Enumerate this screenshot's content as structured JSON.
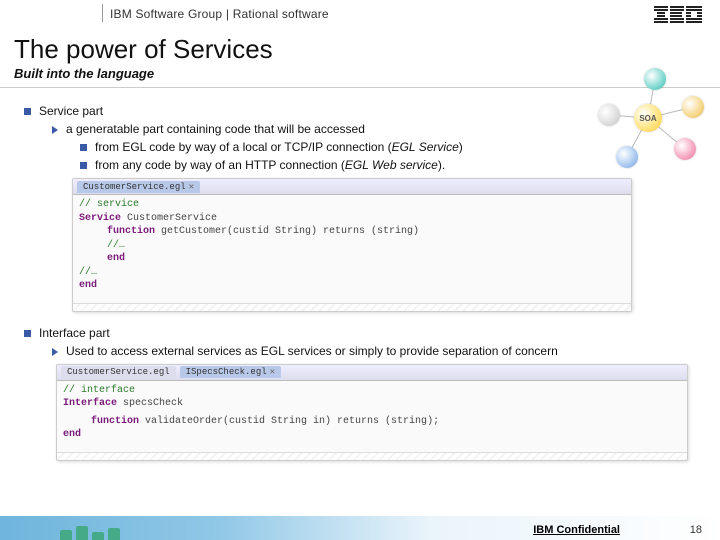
{
  "header": {
    "title": "IBM Software Group | Rational software",
    "logo_alt": "IBM"
  },
  "slide": {
    "title": "The power of Services",
    "subtitle": "Built into the language"
  },
  "soa": {
    "center_label": "SOA"
  },
  "sec1": {
    "heading": "Service part",
    "line1": "a generatable part containing code that will be accessed",
    "bullet1_pre": "from EGL code by way of a local or TCP/IP connection (",
    "bullet1_emph": "EGL Service",
    "bullet1_post": ")",
    "bullet2_pre": "from any code by way of an HTTP connection (",
    "bullet2_emph": "EGL Web service",
    "bullet2_post": ")."
  },
  "snippet1": {
    "tab": "CustomerService.egl",
    "comment": "// service",
    "kw_service": "Service",
    "name": " CustomerService",
    "kw_function": "function",
    "sig": " getCustomer(custid String) returns (string)",
    "ellipsis": "//…",
    "kw_end": "end",
    "kw_end2": "end"
  },
  "sec2": {
    "heading": "Interface part",
    "line1": "Used to access external services as EGL services or simply to provide separation of concern"
  },
  "snippet2": {
    "tab1": "CustomerService.egl",
    "tab2": "ISpecsCheck.egl",
    "comment": "// interface",
    "kw_interface": "Interface",
    "name": " specsCheck",
    "kw_function": "function",
    "sig": " validateOrder(custid String in) returns (string);",
    "kw_end": "end"
  },
  "footer": {
    "confidential": "IBM Confidential",
    "page": "18"
  }
}
